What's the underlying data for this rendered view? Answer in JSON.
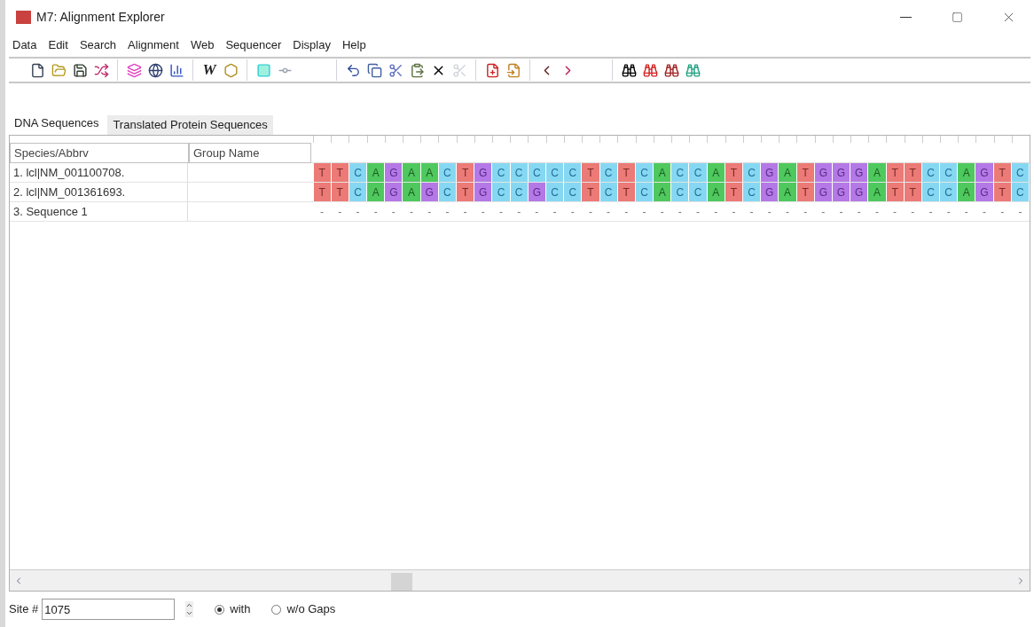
{
  "window": {
    "title": "M7: Alignment Explorer"
  },
  "menu": [
    "Data",
    "Edit",
    "Search",
    "Alignment",
    "Web",
    "Sequencer",
    "Display",
    "Help"
  ],
  "toolbar": {
    "text_button": "W"
  },
  "tabs": [
    {
      "label": "DNA Sequences",
      "selected": true
    },
    {
      "label": "Translated Protein Sequences",
      "selected": false
    }
  ],
  "table": {
    "columns": [
      "Species/Abbrv",
      "Group Name"
    ],
    "rows": [
      {
        "name": "1. lcl|NM_001100708.",
        "bases": [
          "T",
          "T",
          "C",
          "A",
          "G",
          "A",
          "A",
          "C",
          "T",
          "G",
          "C",
          "C",
          "C",
          "C",
          "C",
          "T",
          "C",
          "T",
          "C",
          "A",
          "C",
          "C",
          "A",
          "T",
          "C",
          "G",
          "A",
          "T",
          "G",
          "G",
          "G",
          "A",
          "T",
          "T",
          "C",
          "C",
          "A",
          "G",
          "T",
          "C"
        ]
      },
      {
        "name": "2. lcl|NM_001361693.",
        "bases": [
          "T",
          "T",
          "C",
          "A",
          "G",
          "A",
          "G",
          "C",
          "T",
          "G",
          "C",
          "C",
          "G",
          "C",
          "C",
          "T",
          "C",
          "T",
          "C",
          "A",
          "C",
          "C",
          "A",
          "T",
          "C",
          "G",
          "A",
          "T",
          "G",
          "G",
          "G",
          "A",
          "T",
          "T",
          "C",
          "C",
          "A",
          "G",
          "T",
          "C"
        ]
      },
      {
        "name": "3. Sequence 1",
        "bases": [
          "-",
          "-",
          "-",
          "-",
          "-",
          "-",
          "-",
          "-",
          "-",
          "-",
          "-",
          "-",
          "-",
          "-",
          "-",
          "-",
          "-",
          "-",
          "-",
          "-",
          "-",
          "-",
          "-",
          "-",
          "-",
          "-",
          "-",
          "-",
          "-",
          "-",
          "-",
          "-",
          "-",
          "-",
          "-",
          "-",
          "-",
          "-",
          "-",
          "-"
        ]
      }
    ]
  },
  "status_bar": {
    "site_label": "Site #",
    "site_value": "1075",
    "radios": [
      {
        "label": "with",
        "selected": true
      },
      {
        "label": "w/o Gaps",
        "selected": false
      }
    ]
  }
}
